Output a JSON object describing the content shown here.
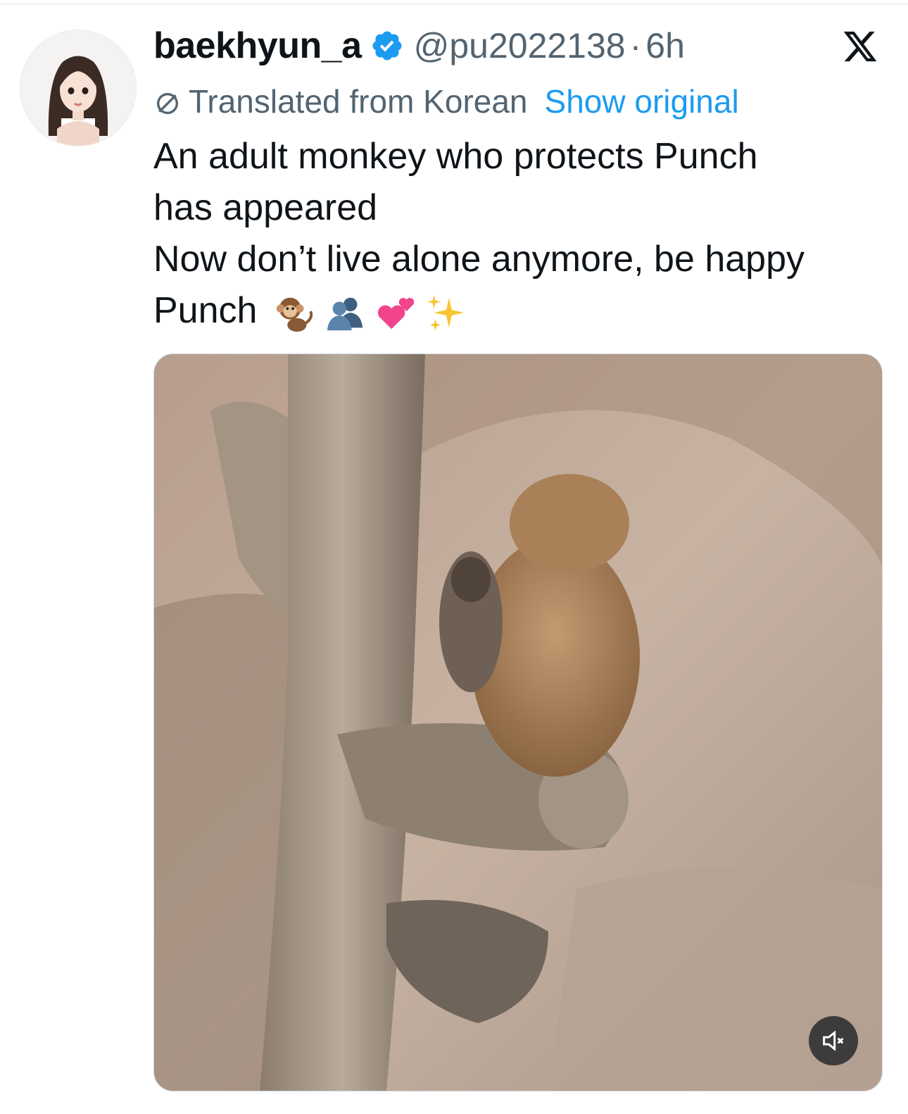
{
  "tweet": {
    "author": {
      "display_name": "baekhyun_a",
      "handle": "@pu2022138",
      "verified": true,
      "avatar_icon": "avatar-woman-long-hair"
    },
    "separator": "·",
    "time": "6h",
    "platform_icon": "x-logo-icon",
    "translation": {
      "icon": "translate-globe-icon",
      "label": "Translated from Korean",
      "action": "Show original"
    },
    "text_lines": [
      "An adult monkey who protects Punch",
      "has appeared",
      "Now don’t live alone anymore, be happy",
      "Punch"
    ],
    "emojis": [
      "monkey-emoji",
      "busts-in-silhouette-emoji",
      "two-hearts-emoji",
      "sparkles-emoji"
    ],
    "media": {
      "type": "video",
      "description_icon": "monkey-video-thumbnail",
      "mute_icon": "speaker-muted-icon"
    }
  },
  "colors": {
    "text_primary": "#0f1419",
    "text_secondary": "#536471",
    "link": "#1d9bf0",
    "verified": "#1d9bf0"
  }
}
